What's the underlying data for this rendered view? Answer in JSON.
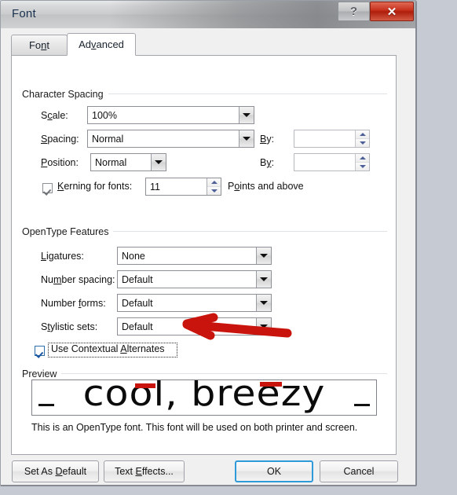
{
  "window": {
    "title": "Font",
    "help_button": "?",
    "close_button": "✕"
  },
  "tabs": [
    {
      "label": "Font",
      "active": false
    },
    {
      "label": "Advanced",
      "active": true
    }
  ],
  "character_spacing": {
    "group_label": "Character Spacing",
    "scale": {
      "label": "Scale:",
      "value": "100%"
    },
    "spacing": {
      "label": "Spacing:",
      "value": "Normal",
      "by_label": "By:",
      "by_value": ""
    },
    "position": {
      "label": "Position:",
      "value": "Normal",
      "by_label": "By:",
      "by_value": ""
    },
    "kerning": {
      "label": "Kerning for fonts:",
      "checked": true,
      "value": "11",
      "suffix": "Points and above"
    }
  },
  "opentype_features": {
    "group_label": "OpenType Features",
    "ligatures": {
      "label": "Ligatures:",
      "value": "None"
    },
    "number_spacing": {
      "label": "Number spacing:",
      "value": "Default"
    },
    "number_forms": {
      "label": "Number forms:",
      "value": "Default"
    },
    "stylistic_sets": {
      "label": "Stylistic sets:",
      "value": "Default"
    },
    "contextual_alternates": {
      "label": "Use Contextual Alternates",
      "checked": true,
      "focused": true
    }
  },
  "preview": {
    "group_label": "Preview",
    "sample_text": "cool, breezy",
    "note": "This is an OpenType font. This font will be used on both printer and screen."
  },
  "footer": {
    "set_as_default": "Set As Default",
    "text_effects": "Text Effects...",
    "ok": "OK",
    "cancel": "Cancel"
  },
  "annotations": {
    "arrow_color": "#c8140c",
    "underline_color": "#c8140c",
    "arrow_target": "Use Contextual Alternates"
  },
  "colors": {
    "accent": "#2e9ada",
    "close_red": "#c6301c",
    "annotation_red": "#c8140c",
    "desktop": "#c6cad2"
  }
}
